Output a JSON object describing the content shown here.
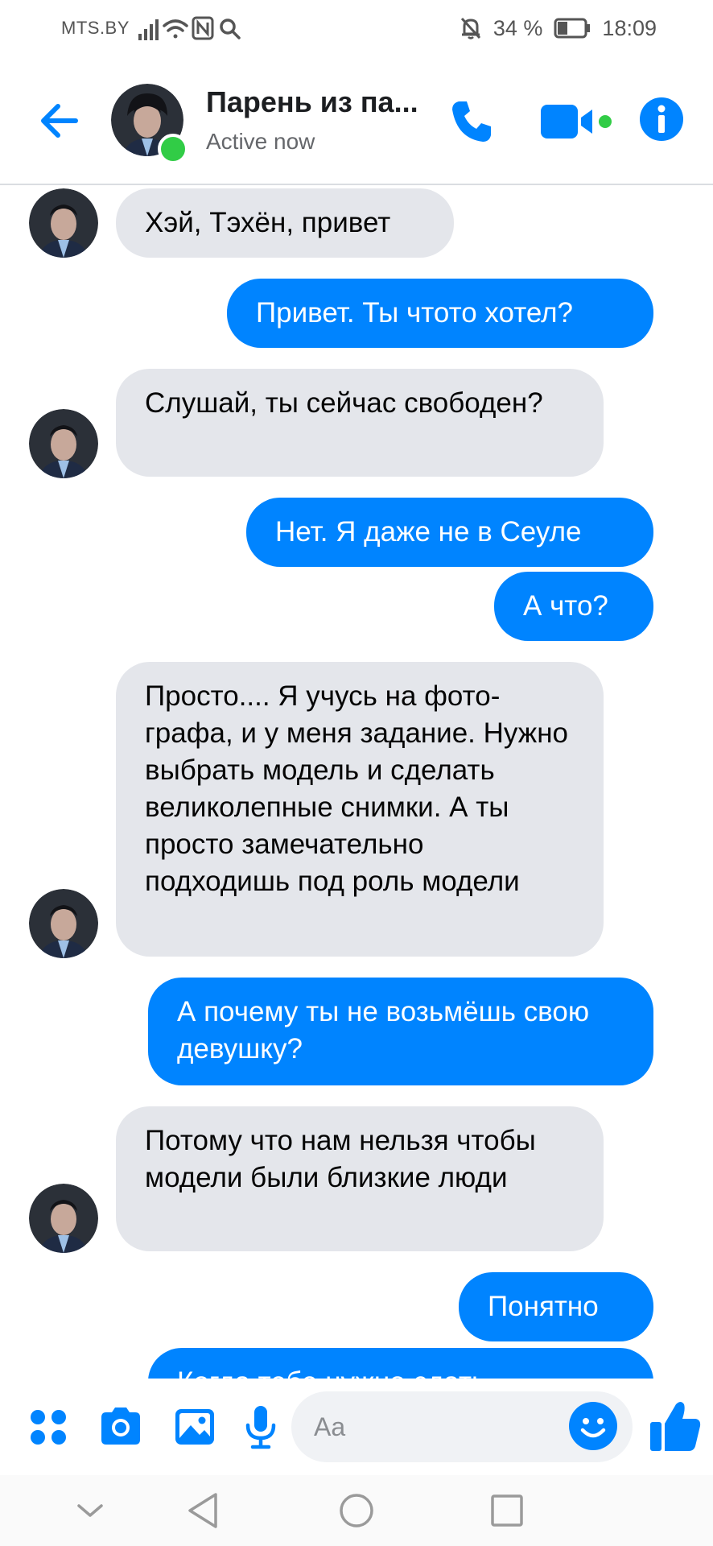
{
  "status_bar": {
    "carrier": "MTS.BY",
    "battery": "34 %",
    "time": "18:09"
  },
  "header": {
    "contact_name": "Парень из па...",
    "contact_status": "Active now"
  },
  "messages": [
    {
      "side": "in",
      "text": "Хэй, Тэхён, привет"
    },
    {
      "side": "out",
      "text": "Привет. Ты чтото хотел?"
    },
    {
      "side": "in",
      "text": "Слушай, ты сейчас свободен?"
    },
    {
      "side": "out",
      "text": "Нет. Я даже не в Сеуле"
    },
    {
      "side": "out",
      "text": "А что?"
    },
    {
      "side": "in",
      "text": "Просто.... Я учусь на фото-графа, и у меня задание. Нужно выбрать модель и сделать великолепные снимки. А ты просто замечательно подходишь под роль модели"
    },
    {
      "side": "out",
      "text": "А почему ты не возьмёшь свою девушку?"
    },
    {
      "side": "in",
      "text": "Потому что нам нельзя чтобы модели были близкие люди"
    },
    {
      "side": "out",
      "text": "Понятно"
    },
    {
      "side": "out",
      "text": "Когда тебе нужно сдать"
    }
  ],
  "composer": {
    "placeholder": "Aa"
  },
  "icons": {
    "status": [
      "signal-icon",
      "wifi-icon",
      "nfc-icon",
      "search-icon",
      "mute-bell-icon",
      "battery-icon"
    ],
    "header": [
      "back-arrow-icon",
      "phone-icon",
      "video-camera-icon",
      "info-icon"
    ],
    "composer": [
      "apps-grid-icon",
      "camera-icon",
      "gallery-icon",
      "microphone-icon",
      "emoji-icon",
      "thumbs-up-icon"
    ],
    "navigation": [
      "nav-hide-icon",
      "nav-back-icon",
      "nav-home-icon",
      "nav-recents-icon"
    ]
  },
  "colors": {
    "accent": "#0084ff",
    "incoming_bubble": "#e4e6eb",
    "online": "#31cc46"
  }
}
